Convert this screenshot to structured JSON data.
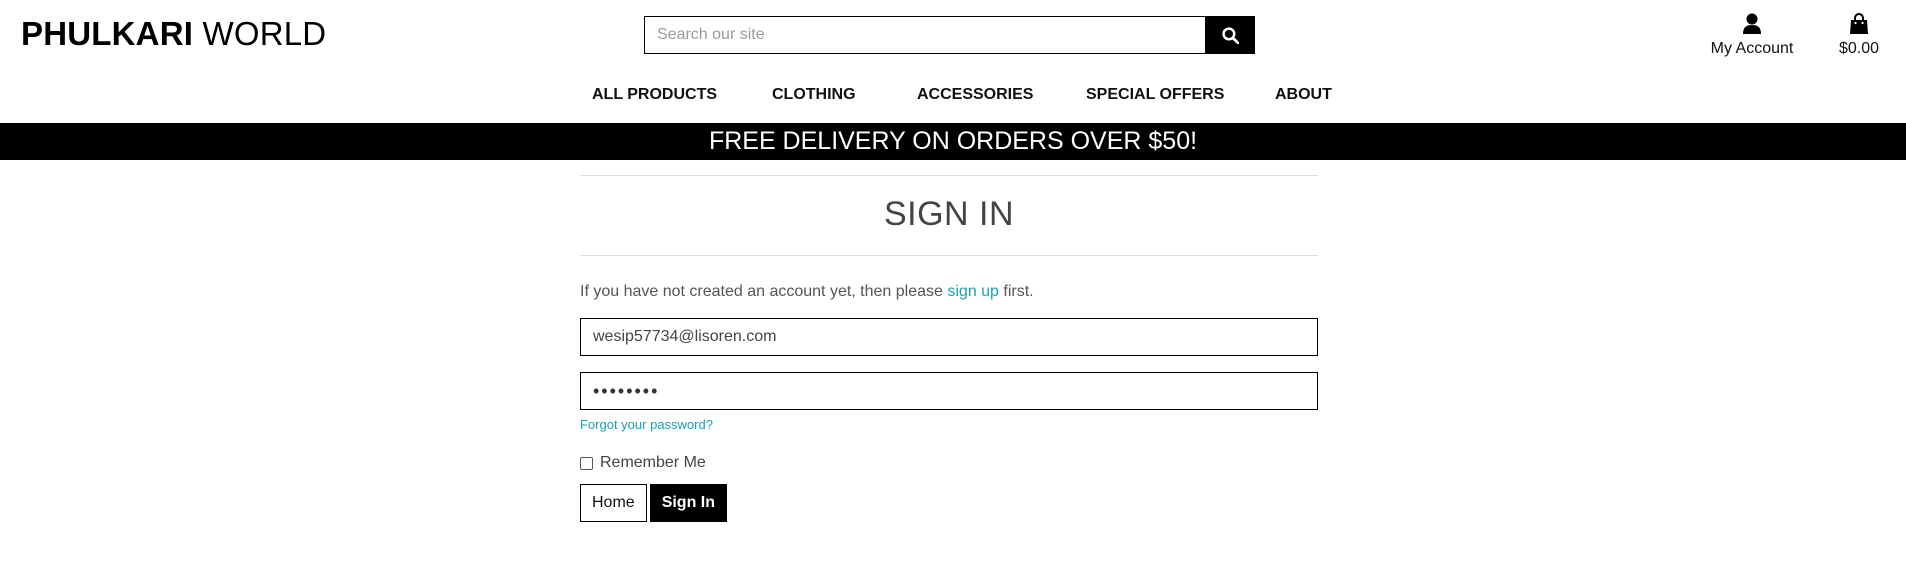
{
  "brand": {
    "bold": "PHULKARI",
    "regular": " WORLD"
  },
  "search": {
    "placeholder": "Search our site",
    "icon": "search-icon"
  },
  "header": {
    "account": {
      "label": "My Account",
      "icon": "user-icon"
    },
    "bag": {
      "label": "$0.00",
      "icon": "shopping-bag-icon"
    }
  },
  "nav": {
    "all_products": "ALL PRODUCTS",
    "clothing": "CLOTHING",
    "accessories": "ACCESSORIES",
    "special_offers": "SPECIAL OFFERS",
    "about": "ABOUT"
  },
  "banner": {
    "text": "FREE DELIVERY ON ORDERS OVER $50!"
  },
  "signin": {
    "title": "SIGN IN",
    "intro_before": "If you have not created an account yet, then please ",
    "intro_link": "sign up",
    "intro_after": " first.",
    "email_value": "wesip57734@lisoren.com",
    "password_value": "••••••••",
    "forgot_link": "Forgot your password?",
    "remember_label": "Remember Me",
    "home_button": "Home",
    "signin_button": "Sign In"
  },
  "colors": {
    "accent": "#17a2b8",
    "banner_bg": "#000000",
    "banner_text": "#ffffff"
  }
}
